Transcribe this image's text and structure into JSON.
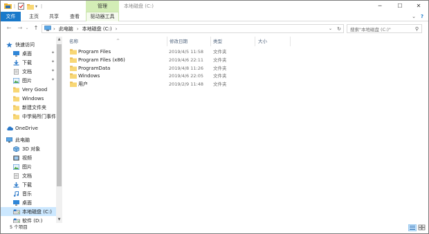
{
  "titlebar": {
    "context_tab": "管理",
    "window_title": "本地磁盘 (C:)",
    "minimize": "─",
    "maximize": "☐",
    "close": "✕"
  },
  "ribbon": {
    "tabs": [
      {
        "label": "文件"
      },
      {
        "label": "主页"
      },
      {
        "label": "共享"
      },
      {
        "label": "查看"
      },
      {
        "label": "驱动器工具"
      }
    ],
    "help_caret": "⌄",
    "help": "?"
  },
  "address": {
    "back": "←",
    "forward": "→",
    "recent": "⌄",
    "up": "↑",
    "crumbs": [
      "此电脑",
      "本地磁盘 (C:)"
    ],
    "separator": "›",
    "dropdown": "⌄",
    "refresh": "↻",
    "search_placeholder": "搜索\"本地磁盘 (C:)\"",
    "search_icon": "⚲"
  },
  "nav": {
    "items": [
      {
        "label": "快速访问",
        "icon": "star-icon",
        "pinned": false
      },
      {
        "label": "桌面",
        "icon": "desktop-icon",
        "pinned": true
      },
      {
        "label": "下载",
        "icon": "download-icon",
        "pinned": true
      },
      {
        "label": "文档",
        "icon": "document-icon",
        "pinned": true
      },
      {
        "label": "图片",
        "icon": "picture-icon",
        "pinned": true
      },
      {
        "label": "Very Good",
        "icon": "folder-icon",
        "pinned": false
      },
      {
        "label": "Windows",
        "icon": "folder-icon",
        "pinned": false
      },
      {
        "label": "新建文件夹",
        "icon": "folder-icon",
        "pinned": false
      },
      {
        "label": "中学局所门事件",
        "icon": "folder-icon",
        "pinned": false
      },
      {
        "label": "OneDrive",
        "icon": "cloud-icon",
        "pinned": false
      },
      {
        "label": "此电脑",
        "icon": "computer-icon",
        "pinned": false
      },
      {
        "label": "3D 对象",
        "icon": "cube-icon",
        "pinned": false
      },
      {
        "label": "视频",
        "icon": "video-icon",
        "pinned": false
      },
      {
        "label": "图片",
        "icon": "picture-icon",
        "pinned": false
      },
      {
        "label": "文档",
        "icon": "document-icon",
        "pinned": false
      },
      {
        "label": "下载",
        "icon": "download-icon",
        "pinned": false
      },
      {
        "label": "音乐",
        "icon": "music-icon",
        "pinned": false
      },
      {
        "label": "桌面",
        "icon": "desktop-icon",
        "pinned": false
      },
      {
        "label": "本地磁盘 (C:)",
        "icon": "drive-icon",
        "pinned": false,
        "selected": true
      },
      {
        "label": "软件 (D:)",
        "icon": "drive-icon",
        "pinned": false
      }
    ],
    "pin_glyph": "✦"
  },
  "list": {
    "columns": {
      "name": "名称",
      "date": "修改日期",
      "type": "类型",
      "size": "大小"
    },
    "sort_caret": "^",
    "files": [
      {
        "name": "Program Files",
        "date": "2019/4/5 11:58",
        "type": "文件夹"
      },
      {
        "name": "Program Files (x86)",
        "date": "2019/4/6 22:11",
        "type": "文件夹"
      },
      {
        "name": "ProgramData",
        "date": "2019/4/8 11:26",
        "type": "文件夹"
      },
      {
        "name": "Windows",
        "date": "2019/4/6 22:05",
        "type": "文件夹"
      },
      {
        "name": "用户",
        "date": "2019/2/9 11:48",
        "type": "文件夹"
      }
    ]
  },
  "status": {
    "item_count": "5 个项目"
  },
  "colors": {
    "accent": "#1979ca",
    "context_tab": "#d3edb6",
    "selection": "#cce8ff",
    "folder": "#f8d775"
  }
}
